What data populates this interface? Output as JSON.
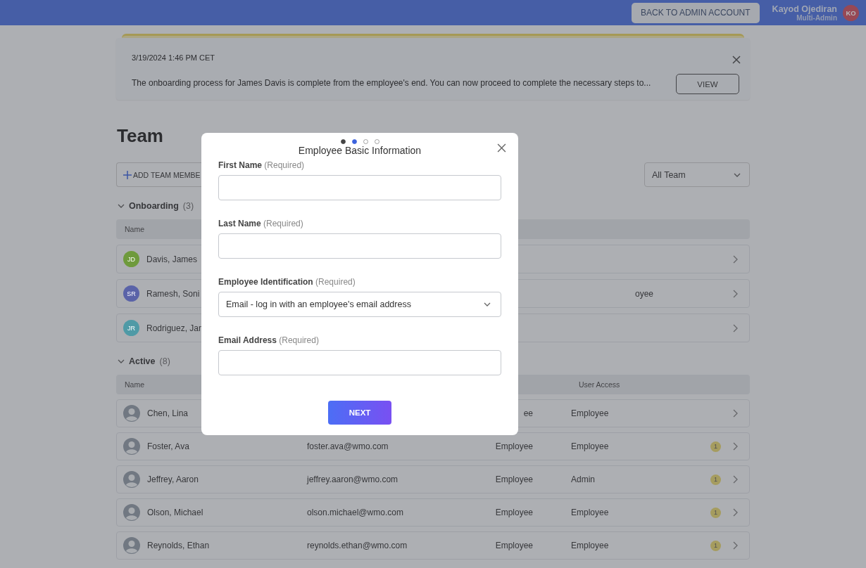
{
  "top_bar": {
    "back_button": "BACK TO ADMIN ACCOUNT",
    "user": {
      "name": "Kayod Ojediran",
      "role": "Multi-Admin",
      "initials": "KO"
    }
  },
  "notification": {
    "timestamp": "3/19/2024 1:46 PM CET",
    "message": "The onboarding process for James Davis is complete from the employee's end. You can now proceed to complete the necessary steps to...",
    "button": "VIEW"
  },
  "page_title": "Team",
  "toolbar": {
    "add_button": "ADD TEAM MEMBE",
    "filter": {
      "value": "All Team"
    }
  },
  "sections": [
    {
      "kind": "onboarding",
      "title": "Onboarding",
      "count": "(3)",
      "expanded": true,
      "columns": [
        {
          "label": "Name"
        }
      ],
      "rows": [
        {
          "name": "Davis, James",
          "initials": "JD",
          "color": "#6e9a3c"
        },
        {
          "name": "Ramesh, Soni",
          "initials": "SR",
          "color": "#5a63a8",
          "type": "oyee"
        },
        {
          "name": "Rodriguez, Jan",
          "initials": "JR",
          "color": "#4f9aa6"
        }
      ]
    },
    {
      "kind": "active",
      "title": "Active",
      "count": "(8)",
      "expanded": true,
      "columns": [
        {
          "label": "Name"
        },
        {
          "label": "User Access"
        }
      ],
      "rows": [
        {
          "name": "Chen, Lina",
          "type": "ee",
          "access": "Employee"
        },
        {
          "name": "Foster, Ava",
          "email": "foster.ava@wmo.com",
          "type": "Employee",
          "access": "Employee",
          "badge": "1"
        },
        {
          "name": "Jeffrey, Aaron",
          "email": "jeffrey.aaron@wmo.com",
          "type": "Employee",
          "access": "Admin",
          "badge": "1"
        },
        {
          "name": "Olson, Michael",
          "email": "olson.michael@wmo.com",
          "type": "Employee",
          "access": "Employee",
          "badge": "1"
        },
        {
          "name": "Reynolds, Ethan",
          "email": "reynolds.ethan@wmo.com",
          "type": "Employee",
          "access": "Employee",
          "badge": "1"
        }
      ]
    }
  ],
  "modal": {
    "title": "Employee Basic Information",
    "steps": [
      {
        "completed": true,
        "selected": false
      },
      {
        "completed": false,
        "selected": true
      },
      {
        "completed": false,
        "selected": false
      },
      {
        "completed": false,
        "selected": false
      }
    ],
    "fields": [
      {
        "kind": "text",
        "label": "First Name",
        "note": "(Required)"
      },
      {
        "kind": "text",
        "label": "Last Name",
        "note": "(Required)"
      },
      {
        "kind": "select",
        "label": "Employee Identification",
        "note": "(Required)",
        "value": "Email - log in with an employee's email address"
      },
      {
        "kind": "text",
        "label": "Email Address",
        "note": "(Required)"
      }
    ],
    "button": "NEXT"
  }
}
